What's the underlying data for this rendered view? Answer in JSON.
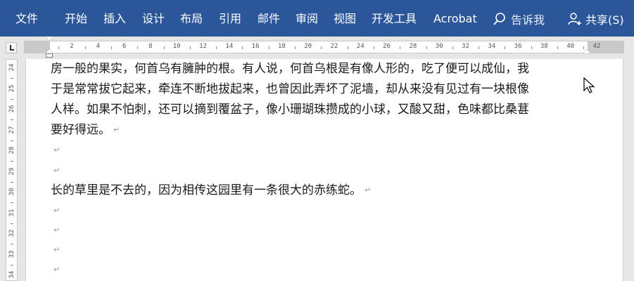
{
  "ribbon": {
    "tabs": [
      "文件",
      "开始",
      "插入",
      "设计",
      "布局",
      "引用",
      "邮件",
      "审阅",
      "视图",
      "开发工具",
      "Acrobat"
    ],
    "tell_me": "告诉我",
    "share": "共享(S)",
    "color": "#2b579a"
  },
  "ruler": {
    "h_numbers": [
      "2",
      "4",
      "6",
      "8",
      "10",
      "12",
      "14",
      "16",
      "18",
      "20",
      "22",
      "24",
      "26",
      "28",
      "30",
      "32",
      "34",
      "36",
      "38",
      "40",
      "42"
    ],
    "v_numbers": [
      "24",
      "25",
      "26",
      "27",
      "28",
      "29",
      "30",
      "31",
      "32",
      "33",
      "34"
    ]
  },
  "document": {
    "lines": [
      "房一般的果实，何首乌有臃肿的根。有人说，何首乌根是有像人形的，吃了便可以成仙，我",
      "于是常常拔它起来，牵连不断地拔起来，也曾因此弄坏了泥墙，却从来没有见过有一块根像",
      "人样。如果不怕刺，还可以摘到覆盆子，像小珊瑚珠攒成的小球，又酸又甜，色味都比桑葚",
      "要好得远。",
      "",
      "",
      "长的草里是不去的，因为相传这园里有一条很大的赤练蛇。",
      "",
      "",
      "",
      ""
    ],
    "pilcrow": "↵"
  }
}
